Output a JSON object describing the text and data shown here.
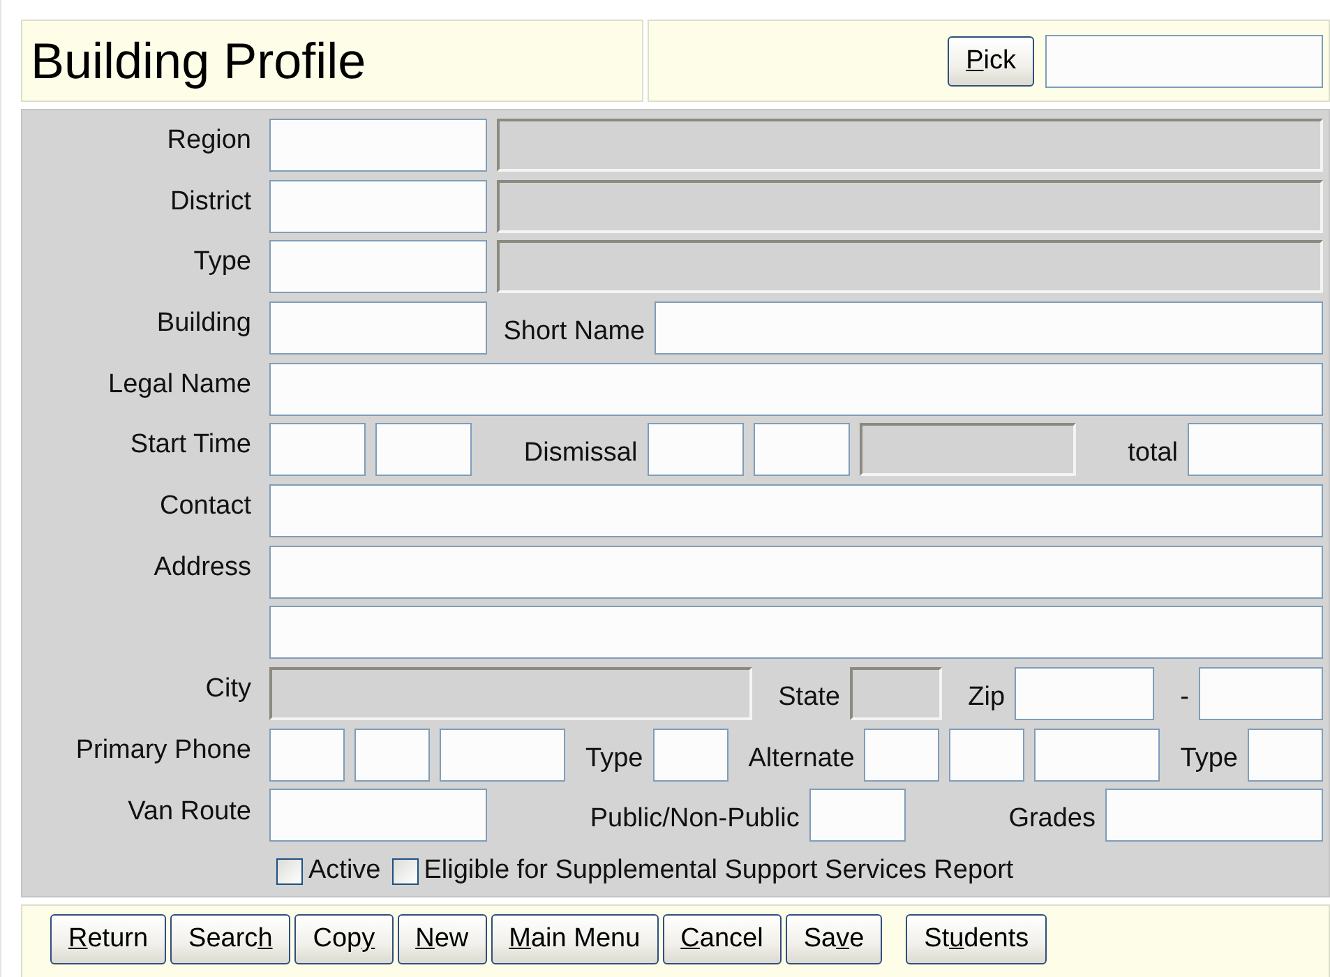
{
  "header": {
    "title": "Building Profile",
    "pick_button": {
      "label": "Pick"
    },
    "pick_field": {
      "kind": "field"
    }
  },
  "rows": [
    {
      "label": "Region",
      "items": [
        {
          "kind": "field"
        },
        {
          "kind": "readonly"
        }
      ]
    },
    {
      "label": "District",
      "items": [
        {
          "kind": "field"
        },
        {
          "kind": "readonly"
        }
      ]
    },
    {
      "label": "Type",
      "items": [
        {
          "kind": "field"
        },
        {
          "kind": "readonly"
        }
      ]
    },
    {
      "label": "Building",
      "items": [
        {
          "kind": "field"
        },
        {
          "kind": "text",
          "text": "Short Name"
        },
        {
          "kind": "field"
        }
      ]
    },
    {
      "label": "Legal Name",
      "items": [
        {
          "kind": "field"
        }
      ]
    },
    {
      "label": "Start Time",
      "items": [
        {
          "kind": "field"
        },
        {
          "kind": "field"
        },
        {
          "kind": "text",
          "text": "Dismissal"
        },
        {
          "kind": "field"
        },
        {
          "kind": "field"
        },
        {
          "kind": "readonly"
        },
        {
          "kind": "text",
          "text": "total"
        },
        {
          "kind": "field"
        }
      ]
    },
    {
      "label": "Contact",
      "items": [
        {
          "kind": "field"
        }
      ]
    },
    {
      "label": "Address",
      "items": [
        {
          "kind": "field"
        }
      ]
    },
    {
      "items": [
        {
          "kind": "field"
        }
      ]
    },
    {
      "label": "City",
      "items": [
        {
          "kind": "readonly"
        },
        {
          "kind": "text",
          "text": "State"
        },
        {
          "kind": "readonly"
        },
        {
          "kind": "text",
          "text": "Zip"
        },
        {
          "kind": "field"
        },
        {
          "kind": "text",
          "text": "-"
        },
        {
          "kind": "field"
        }
      ]
    },
    {
      "label": "Primary Phone",
      "items": [
        {
          "kind": "field"
        },
        {
          "kind": "field"
        },
        {
          "kind": "field"
        },
        {
          "kind": "text",
          "text": "Type"
        },
        {
          "kind": "field"
        },
        {
          "kind": "text",
          "text": "Alternate"
        },
        {
          "kind": "field"
        },
        {
          "kind": "field"
        },
        {
          "kind": "field"
        },
        {
          "kind": "text",
          "text": "Type"
        },
        {
          "kind": "field"
        }
      ]
    },
    {
      "label": "Van Route",
      "items": [
        {
          "kind": "field"
        },
        {
          "kind": "text",
          "text": "Public/Non-Public"
        },
        {
          "kind": "field"
        },
        {
          "kind": "text",
          "text": "Grades"
        },
        {
          "kind": "field"
        }
      ]
    }
  ],
  "checkboxes": [
    {
      "label": "Active",
      "checked": false
    },
    {
      "label": "Eligible for Supplemental Support Services Report",
      "checked": false
    }
  ],
  "buttons": [
    {
      "label": "Return"
    },
    {
      "label": "Search"
    },
    {
      "label": "Copy"
    },
    {
      "label": "New"
    },
    {
      "label": "Main Menu"
    },
    {
      "label": "Cancel"
    },
    {
      "label": "Save"
    },
    {
      "label": "Students"
    }
  ]
}
